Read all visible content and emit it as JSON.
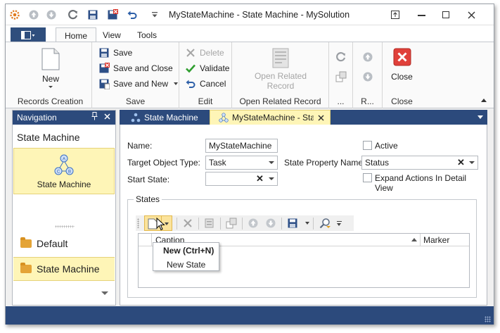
{
  "window": {
    "title": "MyStateMachine - State Machine - MySolution",
    "controls": [
      "pin-icon",
      "minimize-icon",
      "maximize-icon",
      "close-icon"
    ]
  },
  "quick_access": [
    "app-gear-icon",
    "up-arrow-icon",
    "down-arrow-icon",
    "refresh-icon",
    "save-icon",
    "save-and-close-icon",
    "undo-icon",
    "customize-qat-icon"
  ],
  "menu": {
    "tabs": [
      "Home",
      "View",
      "Tools"
    ],
    "active": "Home"
  },
  "ribbon": {
    "records_creation": {
      "label": "Records Creation",
      "new_label": "New"
    },
    "save": {
      "label": "Save",
      "save_label": "Save",
      "save_and_close_label": "Save and Close",
      "save_and_new_label": "Save and New"
    },
    "edit": {
      "label": "Edit",
      "delete_label": "Delete",
      "validate_label": "Validate",
      "cancel_label": "Cancel"
    },
    "open_related": {
      "label": "Open Related Record",
      "button_line1": "Open Related",
      "button_line2": "Record"
    },
    "more": {
      "label": "..."
    },
    "records_nav": {
      "label": "R..."
    },
    "close": {
      "label": "Close",
      "close_label": "Close"
    }
  },
  "navigation": {
    "header": "Navigation",
    "group_title": "State Machine",
    "selected_item": "State Machine",
    "items": [
      "Default",
      "State Machine"
    ],
    "selected_index": 1
  },
  "doc_tabs": {
    "tab1": "State Machine",
    "tab2": "MyStateMachine - State"
  },
  "form": {
    "name_label": "Name:",
    "name_value": "MyStateMachine",
    "target_label": "Target Object Type:",
    "target_value": "Task",
    "start_label": "Start State:",
    "start_value": "",
    "active_label": "Active",
    "active_checked": false,
    "state_prop_label": "State Property Name:",
    "state_prop_value": "Status",
    "expand_label": "Expand Actions In Detail View",
    "expand_checked": false
  },
  "states": {
    "legend": "States",
    "columns": [
      "Caption",
      "Marker"
    ],
    "rows": []
  },
  "tooltip": {
    "title": "New (Ctrl+N)",
    "item": "New State"
  },
  "colors": {
    "accent": "#2c4a7c",
    "selection": "#fef5b7",
    "close_red": "#e0403a",
    "validate_green": "#2f9e2f"
  }
}
